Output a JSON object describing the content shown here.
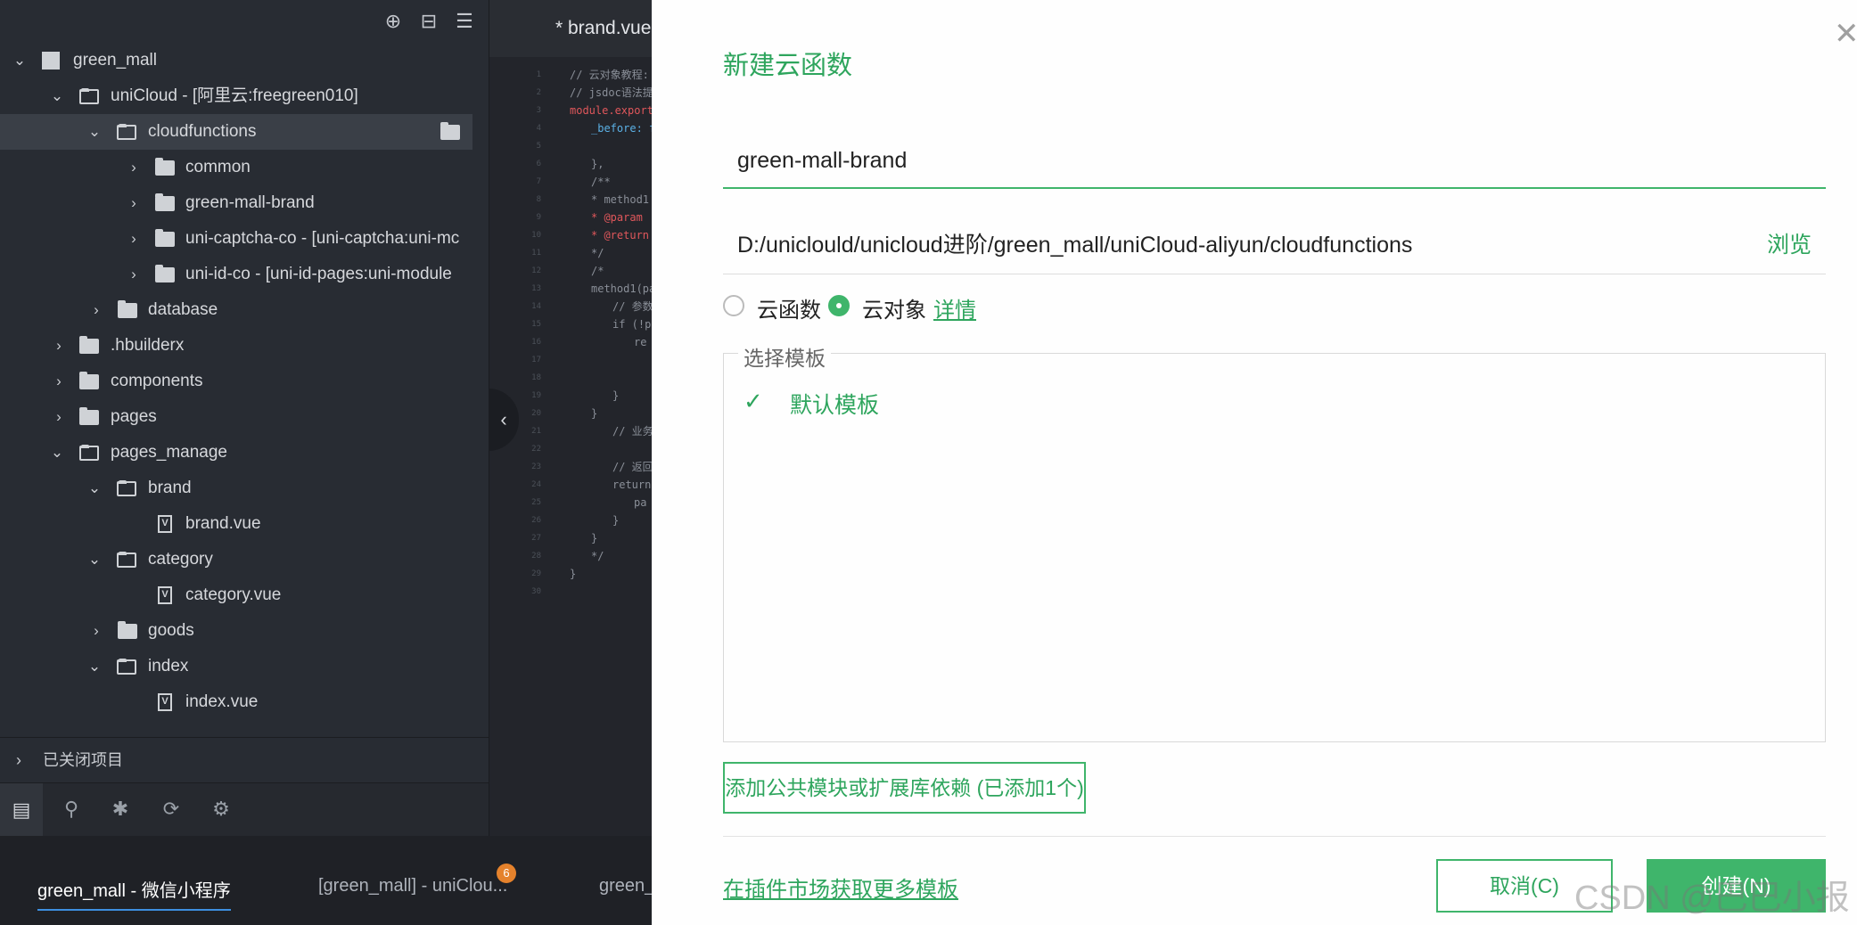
{
  "sidebar": {
    "toolbar": {
      "locate_icon": "crosshair-icon",
      "collapse_icon": "collapse-all-icon",
      "menu_icon": "menu-icon"
    },
    "tree": [
      {
        "label": "green_mall",
        "expanded": true
      },
      {
        "label": "uniCloud - [阿里云:freegreen010]",
        "expanded": true
      },
      {
        "label": "cloudfunctions",
        "expanded": true,
        "selected": true
      },
      {
        "label": "common",
        "expanded": false
      },
      {
        "label": "green-mall-brand",
        "expanded": false
      },
      {
        "label": "uni-captcha-co - [uni-captcha:uni-mc",
        "expanded": false
      },
      {
        "label": "uni-id-co - [uni-id-pages:uni-module",
        "expanded": false
      },
      {
        "label": "database",
        "expanded": false
      },
      {
        "label": ".hbuilderx",
        "expanded": false
      },
      {
        "label": "components",
        "expanded": false
      },
      {
        "label": "pages",
        "expanded": false
      },
      {
        "label": "pages_manage",
        "expanded": true
      },
      {
        "label": "brand",
        "expanded": true
      },
      {
        "label": "brand.vue"
      },
      {
        "label": "category",
        "expanded": true
      },
      {
        "label": "category.vue"
      },
      {
        "label": "goods",
        "expanded": false
      },
      {
        "label": "index",
        "expanded": true
      },
      {
        "label": "index.vue"
      }
    ],
    "closed_projects": "已关闭项目"
  },
  "bottom_tabs": [
    {
      "label": "green_mall - 微信小程序"
    },
    {
      "label": "[green_mall] - uniClou..."
    },
    {
      "label": "green_"
    }
  ],
  "badge_count": "6",
  "editor": {
    "tab": "* brand.vue",
    "lines": [
      "// 云对象教程:",
      "// jsdoc语法提",
      "module.exports",
      "_before: f",
      "",
      "},",
      "/**",
      "* method1",
      "* @param",
      "* @return",
      "*/",
      "/*",
      "method1(pa",
      "// 参数",
      "if (!p",
      "re",
      "",
      "",
      "}",
      "}",
      "// 业务",
      "",
      "// 返回",
      "return",
      "pa",
      "}",
      "}",
      "*/",
      "}",
      ""
    ]
  },
  "dialog": {
    "title": "新建云函数",
    "name_value": "green-mall-brand",
    "path": "D:/uniclould/unicloud进阶/green_mall/uniCloud-aliyun/cloudfunctions",
    "browse": "浏览",
    "radio_function": "云函数",
    "radio_object": "云对象",
    "details": "详情",
    "template_legend": "选择模板",
    "default_template": "默认模板",
    "dep_button": "添加公共模块或扩展库依赖 (已添加1个)",
    "market_link": "在插件市场获取更多模板",
    "cancel": "取消(C)",
    "create": "创建(N)"
  },
  "watermark": "CSDN @巴巴小报",
  "colors": {
    "accent": "#3fb56b",
    "sidebar_bg": "#282c33",
    "editor_bg": "#23252b",
    "dialog_bg": "#fefefe"
  }
}
